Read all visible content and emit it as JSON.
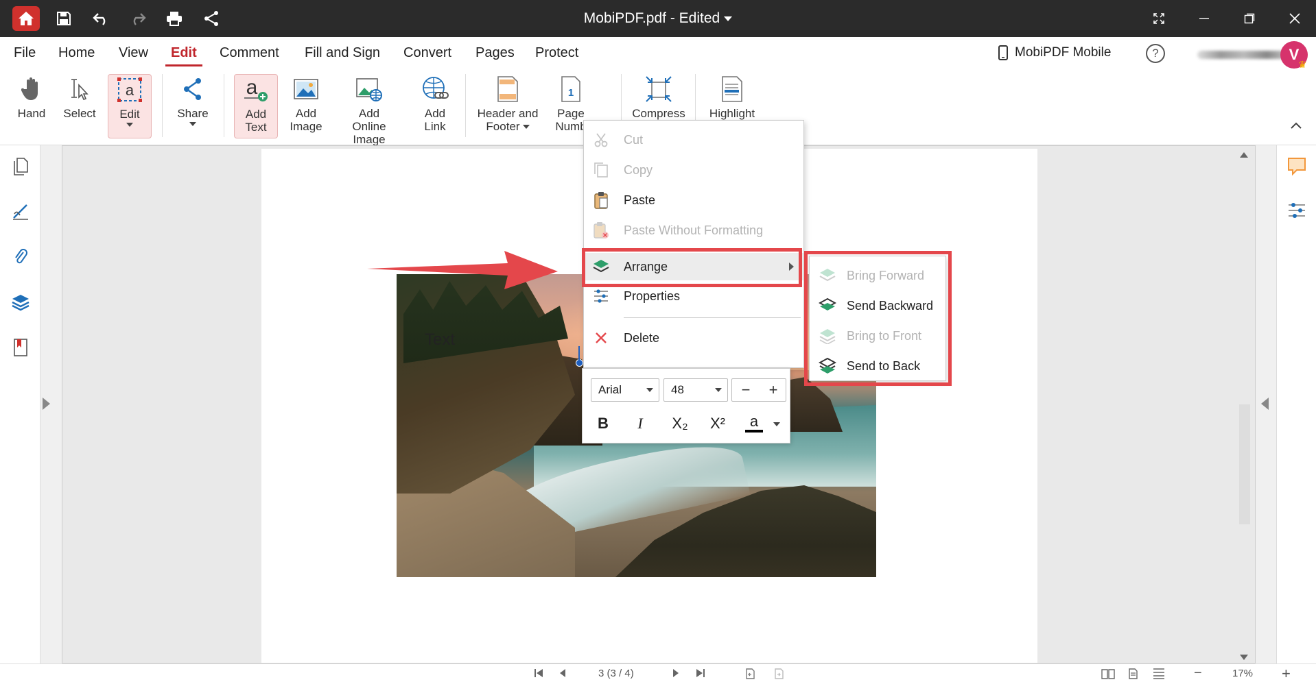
{
  "window": {
    "title": "MobiPDF.pdf - Edited"
  },
  "menu": {
    "items": [
      "File",
      "Home",
      "View",
      "Edit",
      "Comment",
      "Fill and Sign",
      "Convert",
      "Pages",
      "Protect"
    ],
    "active": "Edit",
    "mobile_label": "MobiPDF Mobile",
    "help_symbol": "?",
    "avatar_letter": "V"
  },
  "ribbon": {
    "hand": "Hand",
    "select": "Select",
    "edit": "Edit",
    "share": "Share",
    "add_text": [
      "Add",
      "Text"
    ],
    "add_image": [
      "Add",
      "Image"
    ],
    "add_online_image": [
      "Add",
      "Online Image"
    ],
    "add_link": [
      "Add",
      "Link"
    ],
    "header_footer": [
      "Header and",
      "Footer"
    ],
    "page_number": [
      "Page",
      "Numb"
    ],
    "compress": "Compress",
    "highlight": "Highlight"
  },
  "document": {
    "text_label": "Text"
  },
  "context_menu": {
    "cut": "Cut",
    "copy": "Copy",
    "paste": "Paste",
    "paste_plain": "Paste Without Formatting",
    "arrange": "Arrange",
    "properties": "Properties",
    "delete": "Delete"
  },
  "arrange_submenu": {
    "bring_forward": "Bring Forward",
    "send_backward": "Send Backward",
    "bring_to_front": "Bring to Front",
    "send_to_back": "Send to Back"
  },
  "format_toolbar": {
    "font": "Arial",
    "size": "48",
    "minus": "−",
    "plus": "+",
    "bold": "B",
    "italic": "I",
    "subscript": "X₂",
    "superscript": "X²",
    "color_letter": "a"
  },
  "statusbar": {
    "page": "3 (3 / 4)",
    "zoom": "17%",
    "zoom_minus": "−",
    "zoom_plus": "+"
  },
  "colors": {
    "accent": "#c0262c",
    "highlight": "#e4474b",
    "layer_green": "#2e9e6a",
    "icon_blue": "#1f6fb8"
  }
}
